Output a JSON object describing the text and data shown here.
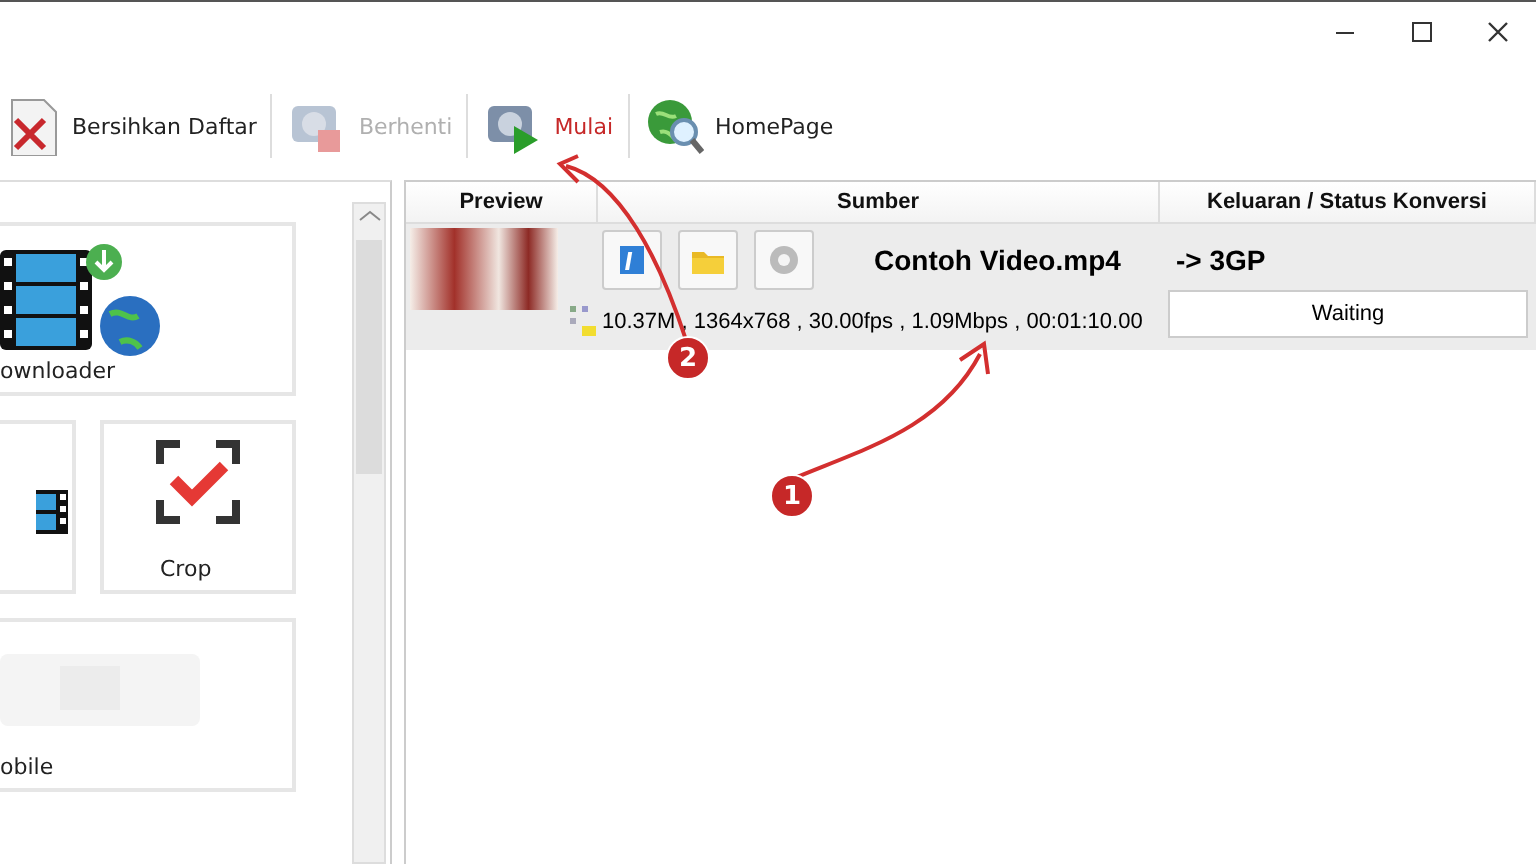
{
  "window": {
    "controls": [
      {
        "kind": "minimize"
      },
      {
        "kind": "maximize"
      },
      {
        "kind": "close"
      }
    ]
  },
  "toolbar": [
    {
      "kind": "clear",
      "label": "Bersihkan Daftar",
      "disabled": false,
      "highlighted": false
    },
    {
      "kind": "stop",
      "label": "Berhenti",
      "disabled": true,
      "highlighted": false
    },
    {
      "kind": "start",
      "label": "Mulai",
      "disabled": false,
      "highlighted": true
    },
    {
      "kind": "home",
      "label": "HomePage",
      "disabled": false,
      "highlighted": false
    }
  ],
  "sidebar": {
    "tiles": [
      {
        "kind": "downloader",
        "label": "ownloader"
      },
      {
        "kind": "film"
      },
      {
        "kind": "crop",
        "label": "Crop"
      },
      {
        "kind": "mobile",
        "label": "obile"
      }
    ]
  },
  "table": {
    "columns": [
      "Preview",
      "Sumber",
      "Keluaran / Status Konversi"
    ],
    "rows": [
      {
        "file": "Contoh Video.mp4",
        "info": "10.37M , 1364x768 , 30.00fps , 1.09Mbps , 00:01:10.00",
        "output": "-> 3GP",
        "status": "Waiting",
        "selected": true
      }
    ]
  },
  "annotations": [
    {
      "number": "1"
    },
    {
      "number": "2"
    }
  ]
}
